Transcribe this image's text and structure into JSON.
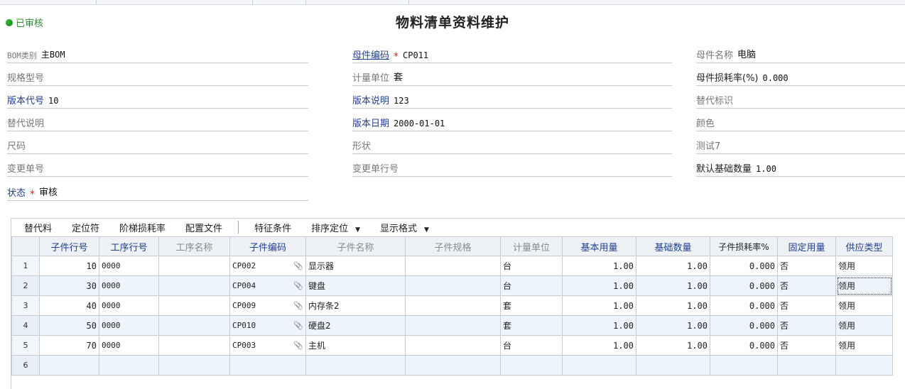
{
  "status_label": "已审核",
  "title": "物料清单资料维护",
  "fields": {
    "bom_type": {
      "label": "BOM类别",
      "value": "主BOM"
    },
    "parent_code": {
      "label": "母件编码",
      "value": "CP011"
    },
    "parent_name": {
      "label": "母件名称",
      "value": "电脑"
    },
    "spec_model": {
      "label": "规格型号",
      "value": ""
    },
    "unit": {
      "label": "计量单位",
      "value": "套"
    },
    "parent_loss": {
      "label": "母件损耗率(%)",
      "value": "0.000"
    },
    "version_code": {
      "label": "版本代号",
      "value": "10"
    },
    "version_desc": {
      "label": "版本说明",
      "value": "123"
    },
    "substitute_flag": {
      "label": "替代标识",
      "value": ""
    },
    "substitute_desc": {
      "label": "替代说明",
      "value": ""
    },
    "version_date": {
      "label": "版本日期",
      "value": "2000-01-01"
    },
    "color": {
      "label": "颜色",
      "value": ""
    },
    "size": {
      "label": "尺码",
      "value": ""
    },
    "shape": {
      "label": "形状",
      "value": ""
    },
    "test7": {
      "label": "测试7",
      "value": ""
    },
    "change_no": {
      "label": "变更单号",
      "value": ""
    },
    "change_line": {
      "label": "变更单行号",
      "value": ""
    },
    "default_base_qty": {
      "label": "默认基础数量",
      "value": "1.00"
    },
    "state": {
      "label": "状态",
      "value": "审核"
    }
  },
  "toolbar": {
    "substitute": "替代料",
    "locator": "定位符",
    "ladder_loss": "阶梯损耗率",
    "config_file": "配置文件",
    "feature_cond": "特征条件",
    "sort_locate": "排序定位",
    "display_format": "显示格式"
  },
  "columns": [
    "子件行号",
    "工序行号",
    "工序名称",
    "子件编码",
    "子件名称",
    "子件规格",
    "计量单位",
    "基本用量",
    "基础数量",
    "子件损耗率%",
    "固定用量",
    "供应类型"
  ],
  "rows": [
    {
      "n": "1",
      "line": "10",
      "op": "0000",
      "opname": "",
      "code": "CP002",
      "name": "显示器",
      "spec": "",
      "unit": "台",
      "usage": "1.00",
      "base": "1.00",
      "loss": "0.000",
      "fixed": "否",
      "supply": "领用"
    },
    {
      "n": "2",
      "line": "30",
      "op": "0000",
      "opname": "",
      "code": "CP004",
      "name": "键盘",
      "spec": "",
      "unit": "台",
      "usage": "1.00",
      "base": "1.00",
      "loss": "0.000",
      "fixed": "否",
      "supply": "领用"
    },
    {
      "n": "3",
      "line": "40",
      "op": "0000",
      "opname": "",
      "code": "CP009",
      "name": "内存条2",
      "spec": "",
      "unit": "套",
      "usage": "1.00",
      "base": "1.00",
      "loss": "0.000",
      "fixed": "否",
      "supply": "领用"
    },
    {
      "n": "4",
      "line": "50",
      "op": "0000",
      "opname": "",
      "code": "CP010",
      "name": "硬盘2",
      "spec": "",
      "unit": "套",
      "usage": "1.00",
      "base": "1.00",
      "loss": "0.000",
      "fixed": "否",
      "supply": "领用"
    },
    {
      "n": "5",
      "line": "70",
      "op": "0000",
      "opname": "",
      "code": "CP003",
      "name": "主机",
      "spec": "",
      "unit": "台",
      "usage": "1.00",
      "base": "1.00",
      "loss": "0.000",
      "fixed": "否",
      "supply": "领用"
    },
    {
      "n": "6",
      "line": "",
      "op": "",
      "opname": "",
      "code": "",
      "name": "",
      "spec": "",
      "unit": "",
      "usage": "",
      "base": "",
      "loss": "",
      "fixed": "",
      "supply": ""
    }
  ],
  "icons": {
    "status": "green-dot-icon",
    "attachment": "paperclip-icon",
    "dropdown": "triangle-down-icon"
  },
  "colors": {
    "accent_blue": "#1f3f8f",
    "required": "#e02020",
    "approved_green": "#2e8b2e"
  }
}
